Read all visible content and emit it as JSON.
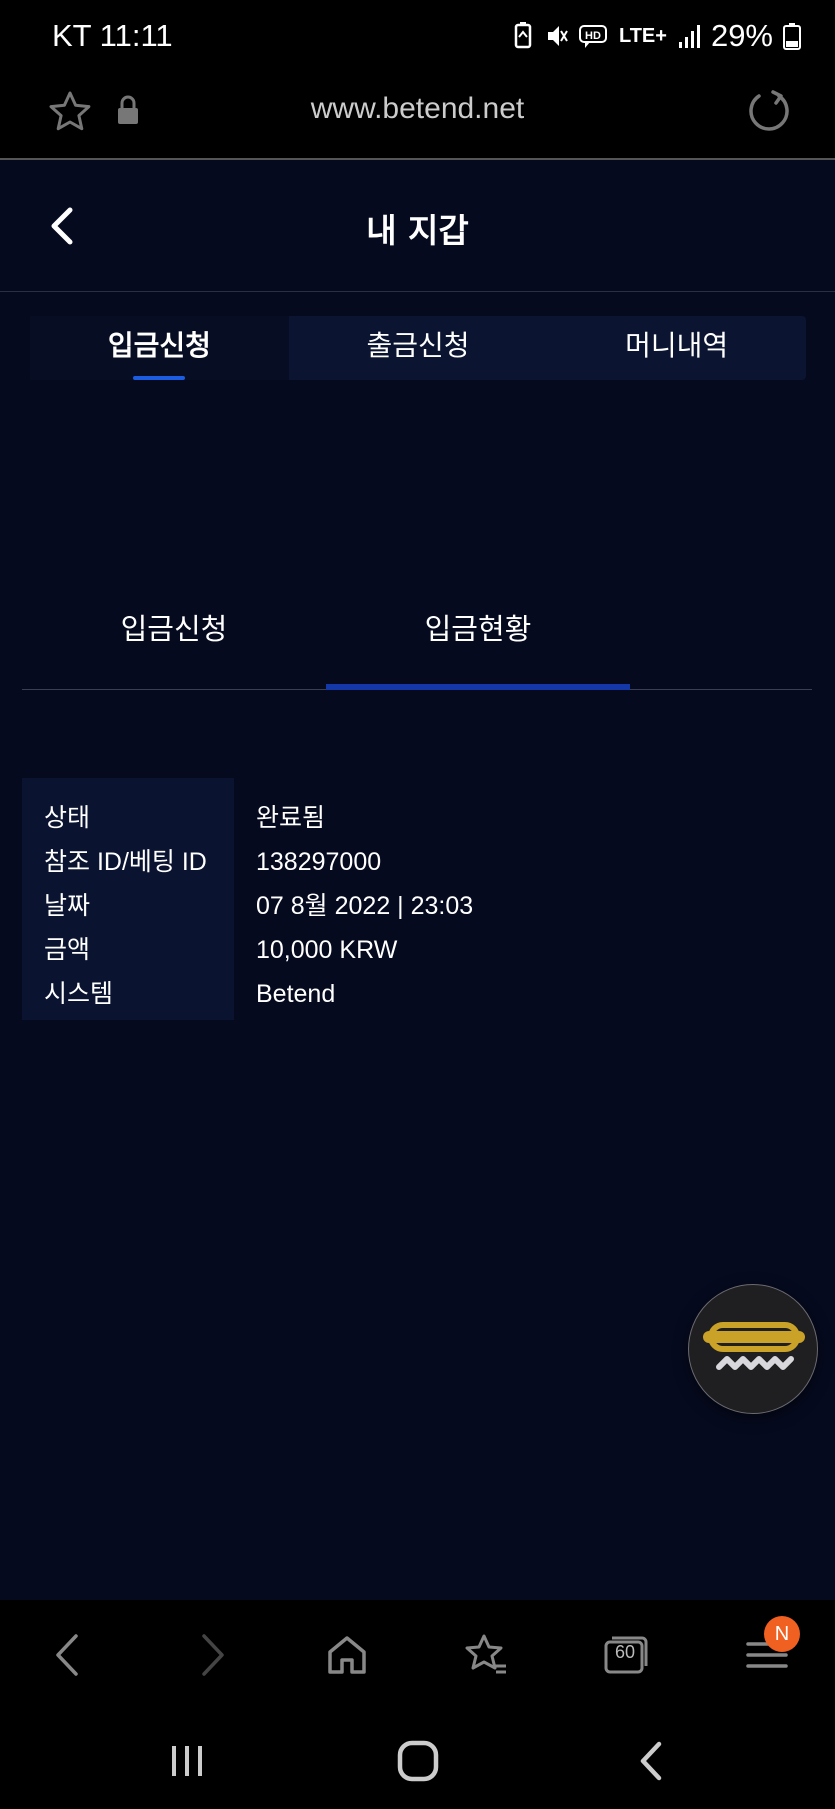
{
  "status_bar": {
    "carrier_time": "KT 11:11",
    "network": "LTE+",
    "battery": "29%"
  },
  "browser": {
    "url": "www.betend.net",
    "tab_count": "60",
    "menu_badge": "N"
  },
  "header": {
    "title": "내 지갑"
  },
  "tabs": [
    {
      "label": "입금신청",
      "active": true
    },
    {
      "label": "출금신청",
      "active": false
    },
    {
      "label": "머니내역",
      "active": false
    }
  ],
  "subtabs": [
    {
      "label": "입금신청",
      "active": false
    },
    {
      "label": "입금현황",
      "active": true
    }
  ],
  "details": [
    {
      "label": "상태",
      "value": "완료됨"
    },
    {
      "label": "참조 ID/베팅 ID",
      "value": "138297000"
    },
    {
      "label": "날짜",
      "value": "07 8월 2022 | 23:03"
    },
    {
      "label": "금액",
      "value": "10,000 KRW"
    },
    {
      "label": "시스템",
      "value": "Betend"
    }
  ],
  "colors": {
    "background": "#050a1f",
    "tab_bar": "#0b1430",
    "accent_blue": "#1c5ce0",
    "fab_gold": "#c9a227",
    "badge": "#f06020"
  }
}
